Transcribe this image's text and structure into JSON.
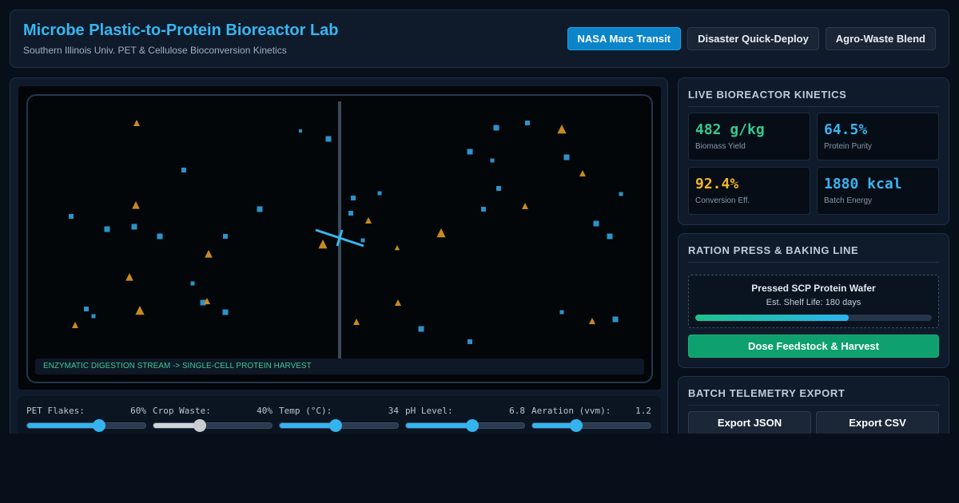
{
  "header": {
    "title": "Microbe Plastic-to-Protein Bioreactor Lab",
    "subtitle": "Southern Illinois Univ. PET & Cellulose Bioconversion Kinetics",
    "presets": [
      {
        "label": "NASA Mars Transit",
        "active": true
      },
      {
        "label": "Disaster Quick-Deploy",
        "active": false
      },
      {
        "label": "Agro-Waste Blend",
        "active": false
      }
    ]
  },
  "simulation": {
    "caption": "ENZYMATIC DIGESTION STREAM -> SINGLE-CELL PROTEIN HARVEST",
    "particle_colors": {
      "pet": "#2b93c9",
      "cellulose": "#c98a1d",
      "impeller": "#38b6f0"
    }
  },
  "controls": [
    {
      "label": "PET Flakes:",
      "value": "60%",
      "fraction": 0.61,
      "style": "accent"
    },
    {
      "label": "Crop Waste:",
      "value": "40%",
      "fraction": 0.39,
      "style": "grey"
    },
    {
      "label": "Temp (°C):",
      "value": "34",
      "fraction": 0.47,
      "style": "accent"
    },
    {
      "label": "pH Level:",
      "value": "6.8",
      "fraction": 0.56,
      "style": "accent"
    },
    {
      "label": "Aeration (vvm):",
      "value": "1.2",
      "fraction": 0.37,
      "style": "accent"
    }
  ],
  "kinetics": {
    "title": "LIVE BIOREACTOR KINETICS",
    "metrics": [
      {
        "value": "482 g/kg",
        "label": "Biomass Yield",
        "color": "#35c98f"
      },
      {
        "value": "64.5%",
        "label": "Protein Purity",
        "color": "#3ab4f0"
      },
      {
        "value": "92.4%",
        "label": "Conversion Eff.",
        "color": "#f0b429"
      },
      {
        "value": "1880 kcal",
        "label": "Batch Energy",
        "color": "#3ab4f0"
      }
    ]
  },
  "ration": {
    "title": "RATION PRESS & BAKING LINE",
    "product_name": "Pressed SCP Protein Wafer",
    "shelf_life": "Est. Shelf Life: 180 days",
    "progress": 0.65,
    "dose_button": "Dose Feedstock & Harvest"
  },
  "telemetry": {
    "title": "BATCH TELEMETRY EXPORT",
    "export_json": "Export JSON",
    "export_csv": "Export CSV"
  }
}
